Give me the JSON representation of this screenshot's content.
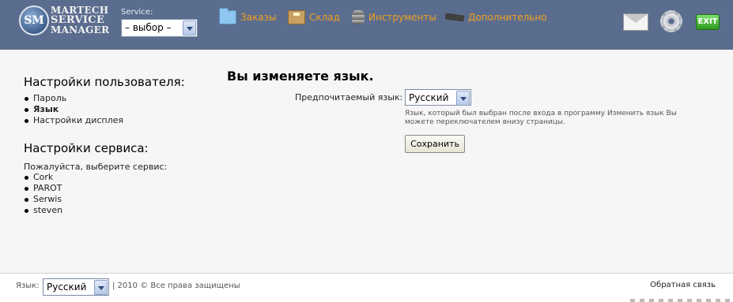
{
  "logo": {
    "badge": "SM",
    "line1": "MARTECH",
    "line2": "SERVICE",
    "line3": "MANAGER"
  },
  "service": {
    "label": "Service:",
    "selected": "– выбор –"
  },
  "nav": {
    "orders": "Заказы",
    "warehouse": "Склад",
    "tools": "Инструменты",
    "extra": "Дополнительно"
  },
  "header_icons": {
    "exit": "EXIT"
  },
  "left": {
    "user_settings_title": "Настройки пользователя:",
    "user_links": [
      "Пароль",
      "Язык",
      "Настройки дисплея"
    ],
    "service_settings_title": "Настройки сервиса:",
    "service_prompt": "Пожалуйста, выберите сервис:",
    "services": [
      "Cork",
      "PAROT",
      "Serwis",
      "steven"
    ]
  },
  "main": {
    "title": "Вы изменяете язык.",
    "pref_label": "Предпочитаемый язык:",
    "lang_selected": "Русский",
    "help": "Язык, который был выбран после входа в программу Изменить язык Вы можете переключателем внизу страницы.",
    "save": "Сохранить"
  },
  "footer": {
    "lang_label": "Язык:",
    "lang_selected": "Русский",
    "copyright": "| 2010 © Все права защищены",
    "feedback": "Обратная связь"
  }
}
